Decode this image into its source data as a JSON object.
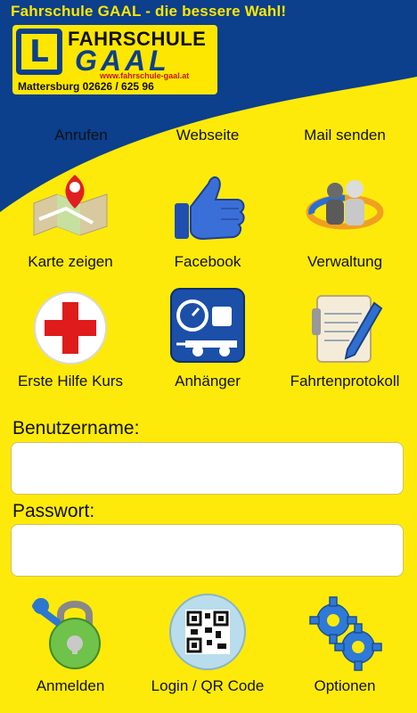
{
  "header": {
    "tagline": "Fahrschule GAAL - die bessere Wahl!",
    "logo": {
      "line1": "FAHRSCHULE",
      "line2": "GAAL",
      "letter": "L",
      "url": "www.fahrschule-gaal.at",
      "address": "Mattersburg   02626 / 625 96"
    }
  },
  "quick_links": [
    {
      "label": "Anrufen"
    },
    {
      "label": "Webseite"
    },
    {
      "label": "Mail senden"
    }
  ],
  "tiles": [
    {
      "label": "Karte zeigen",
      "icon": "map-pin-icon"
    },
    {
      "label": "Facebook",
      "icon": "thumbs-up-icon"
    },
    {
      "label": "Verwaltung",
      "icon": "people-sync-icon"
    },
    {
      "label": "Erste Hilfe Kurs",
      "icon": "red-cross-icon"
    },
    {
      "label": "Anhänger",
      "icon": "trailer-weight-icon"
    },
    {
      "label": "Fahrtenprotokoll",
      "icon": "clipboard-pen-icon"
    }
  ],
  "login": {
    "username_label": "Benutzername:",
    "username_value": "",
    "password_label": "Passwort:",
    "password_value": ""
  },
  "bottom_actions": [
    {
      "label": "Anmelden",
      "icon": "key-lock-icon"
    },
    {
      "label": "Login / QR Code",
      "icon": "qr-code-icon"
    },
    {
      "label": "Optionen",
      "icon": "gears-icon"
    }
  ],
  "colors": {
    "background": "#fdea0a",
    "header_blue": "#0c3f8c",
    "accent_red": "#e01b1b"
  }
}
